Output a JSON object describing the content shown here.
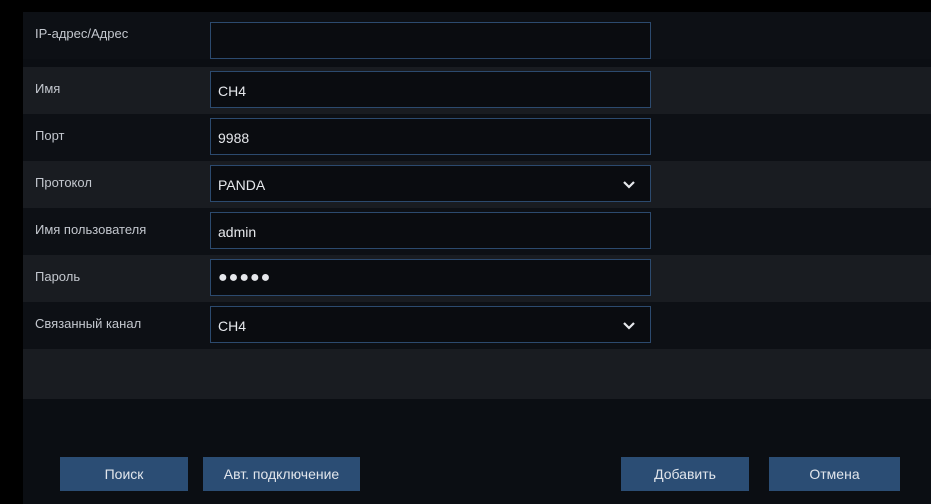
{
  "form": {
    "rows": [
      {
        "label": "IP-адрес/Адрес",
        "value": ""
      },
      {
        "label": "Имя",
        "value": "CH4"
      },
      {
        "label": "Порт",
        "value": "9988"
      },
      {
        "label": "Протокол",
        "value": "PANDA"
      },
      {
        "label": "Имя пользователя",
        "value": "admin"
      },
      {
        "label": "Пароль",
        "value": "●●●●●"
      },
      {
        "label": "Связанный канал",
        "value": "CH4"
      }
    ]
  },
  "buttons": {
    "search": "Поиск",
    "auto_connect": "Авт. подключение",
    "add": "Добавить",
    "cancel": "Отмена"
  },
  "colors": {
    "button_bg": "#2b4d74",
    "field_border": "#2c4a6e",
    "row_alt": "#191c21"
  },
  "icons": {
    "dropdown": "chevron-down-icon"
  }
}
